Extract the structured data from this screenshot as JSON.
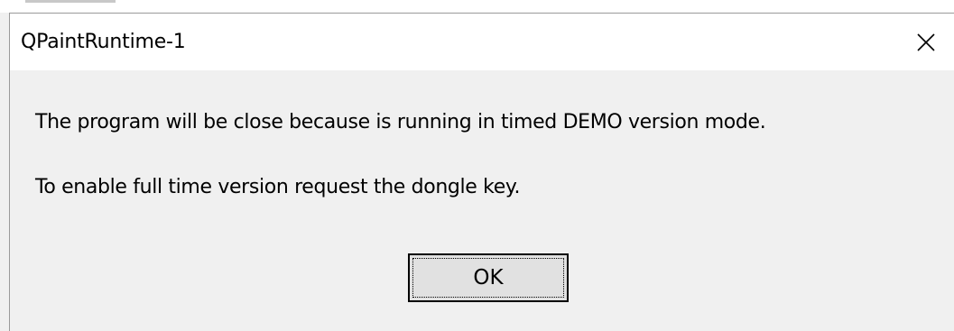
{
  "window": {
    "title": "QPaintRuntime-1",
    "close_icon": "close-icon"
  },
  "message": {
    "line1": "The program will be close because is running in timed DEMO version mode.",
    "line2": "To enable full time version request the dongle key."
  },
  "buttons": {
    "ok_label": "OK"
  },
  "colors": {
    "titlebar_bg": "#ffffff",
    "client_bg": "#f0f0f0",
    "button_bg": "#e1e1e1",
    "border": "#9a9a9a"
  }
}
